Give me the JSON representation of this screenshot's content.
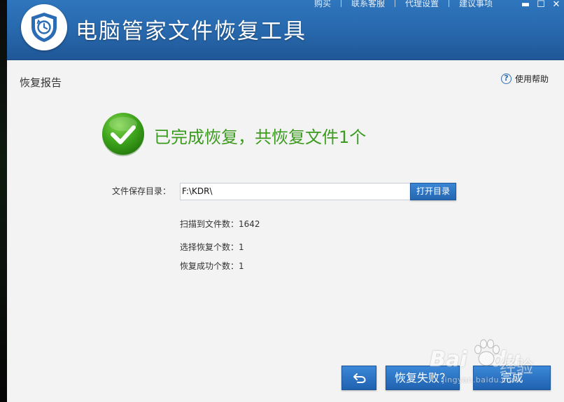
{
  "app": {
    "title": "电脑管家文件恢复工具"
  },
  "top_links": [
    {
      "label": "购买"
    },
    {
      "label": "联系客服"
    },
    {
      "label": "代理设置"
    },
    {
      "label": "建议事项"
    }
  ],
  "window_controls": {
    "minimize": "▬",
    "maximize": "☐",
    "close": "✕"
  },
  "section": {
    "title": "恢复报告",
    "help_icon": "?",
    "help_label": "使用帮助"
  },
  "result": {
    "message": "已完成恢复，共恢复文件1个",
    "icon": "check-circle-icon",
    "color": "#3b9b1e"
  },
  "save_dir": {
    "label": "文件保存目录：",
    "value": "F:\\KDR\\",
    "open_button": "打开目录"
  },
  "stats": {
    "scanned": "扫描到文件数：1642",
    "selected": "选择恢复个数：1",
    "success": "恢复成功个数：1"
  },
  "buttons": {
    "back_icon": "undo-arrow-icon",
    "fail": "恢复失败？",
    "done": "完成"
  },
  "watermark": {
    "brand": "Bai",
    "brand2": "du",
    "jingyan": "经验",
    "url": "jingyan.baidu.com"
  },
  "colors": {
    "header_blue": "#2767ab",
    "button_blue": "#2a6cb5",
    "success_green": "#3b9b1e"
  }
}
